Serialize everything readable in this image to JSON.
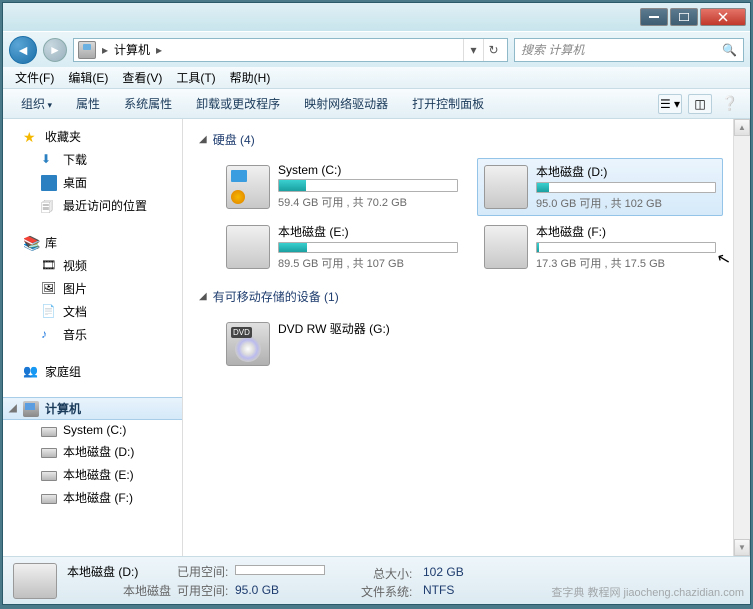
{
  "address": {
    "root": "计算机",
    "sep": "▸"
  },
  "search": {
    "placeholder": "搜索 计算机"
  },
  "menu": [
    "文件(F)",
    "编辑(E)",
    "查看(V)",
    "工具(T)",
    "帮助(H)"
  ],
  "toolbar": {
    "organize": "组织",
    "items": [
      "属性",
      "系统属性",
      "卸载或更改程序",
      "映射网络驱动器",
      "打开控制面板"
    ]
  },
  "nav": {
    "fav": {
      "label": "收藏夹",
      "items": [
        "下载",
        "桌面",
        "最近访问的位置"
      ]
    },
    "lib": {
      "label": "库",
      "items": [
        "视频",
        "图片",
        "文档",
        "音乐"
      ]
    },
    "home": {
      "label": "家庭组"
    },
    "comp": {
      "label": "计算机",
      "items": [
        "System (C:)",
        "本地磁盘 (D:)",
        "本地磁盘 (E:)",
        "本地磁盘 (F:)"
      ]
    }
  },
  "sections": {
    "hdd": "硬盘 (4)",
    "removable": "有可移动存储的设备 (1)"
  },
  "drives": [
    {
      "name": "System (C:)",
      "stat": "59.4 GB 可用 , 共 70.2 GB",
      "fill": 15,
      "sys": true
    },
    {
      "name": "本地磁盘 (D:)",
      "stat": "95.0 GB 可用 , 共 102 GB",
      "fill": 7,
      "selected": true
    },
    {
      "name": "本地磁盘 (E:)",
      "stat": "89.5 GB 可用 , 共 107 GB",
      "fill": 16
    },
    {
      "name": "本地磁盘 (F:)",
      "stat": "17.3 GB 可用 , 共 17.5 GB",
      "fill": 1
    }
  ],
  "dvd": {
    "name": "DVD RW 驱动器 (G:)"
  },
  "status": {
    "title": "本地磁盘 (D:)",
    "used_label": "已用空间:",
    "free_label": "可用空间:",
    "free": "95.0 GB",
    "total_label": "总大小:",
    "total": "102 GB",
    "fs_label": "文件系统:",
    "fs": "NTFS",
    "fill": 7
  },
  "watermark": "查字典 教程网 jiaocheng.chazidian.com"
}
